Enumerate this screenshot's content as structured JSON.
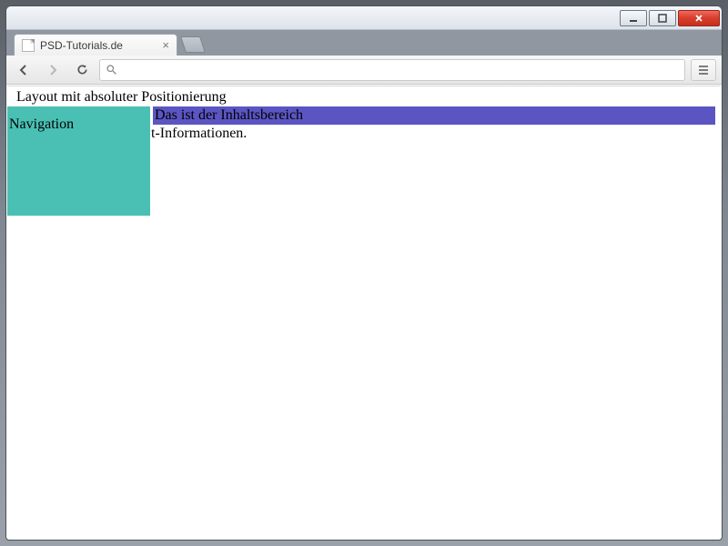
{
  "window": {
    "tab_title": "PSD-Tutorials.de"
  },
  "page": {
    "heading": "Layout mit absoluter Positionierung",
    "content_label": "Das ist der Inhaltsbereich",
    "info_text": "t-Informationen.",
    "nav_label": "Navigation"
  }
}
